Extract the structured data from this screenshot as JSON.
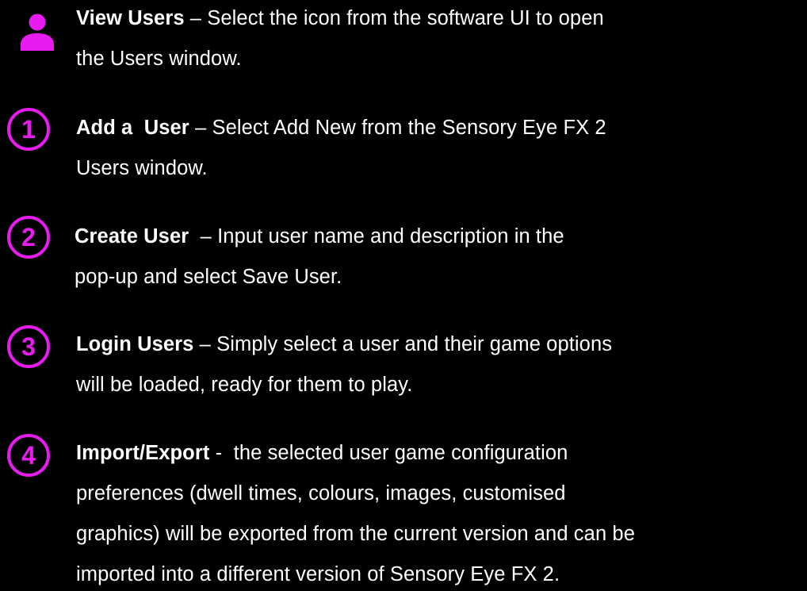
{
  "colors": {
    "accent": "#e81cf0",
    "background": "#000000",
    "text": "#ffffff"
  },
  "steps": [
    {
      "icon": "user-icon",
      "title": "View Users",
      "sep": " – ",
      "line1": "Select the icon from the software UI to open",
      "lines": [
        "the Users window."
      ]
    },
    {
      "badge": "1",
      "title": "Add a  User",
      "sep": " – ",
      "line1": "Select Add New from the Sensory Eye FX 2",
      "lines": [
        "Users window."
      ]
    },
    {
      "badge": "2",
      "title": "Create User",
      "sep": "  – ",
      "line1": "Input user name and description in the",
      "lines": [
        "pop-up and select Save User."
      ]
    },
    {
      "badge": "3",
      "title": "Login Users",
      "sep": " – ",
      "line1": "Simply select a user and their game options",
      "lines": [
        "will be loaded, ready for them to play."
      ]
    },
    {
      "badge": "4",
      "title": "Import/Export",
      "sep": " -  ",
      "line1": "the selected user game configuration",
      "lines": [
        "preferences (dwell times, colours, images, customised",
        "graphics) will be exported from the current version and can be",
        "imported into a different version of Sensory Eye FX 2."
      ]
    }
  ]
}
